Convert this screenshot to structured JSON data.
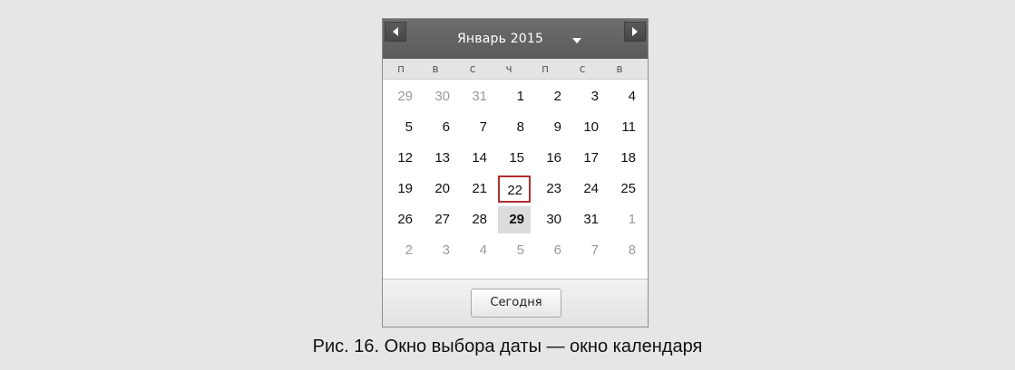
{
  "calendar": {
    "month_title": "Январь 2015",
    "prev_icon": "triangle-left-icon",
    "next_icon": "triangle-right-icon",
    "dropdown_icon": "triangle-down-icon",
    "weekdays": [
      "п",
      "в",
      "с",
      "ч",
      "п",
      "с",
      "в"
    ],
    "weeks": [
      [
        {
          "d": "29",
          "other": true
        },
        {
          "d": "30",
          "other": true
        },
        {
          "d": "31",
          "other": true
        },
        {
          "d": "1"
        },
        {
          "d": "2"
        },
        {
          "d": "3"
        },
        {
          "d": "4"
        }
      ],
      [
        {
          "d": "5"
        },
        {
          "d": "6"
        },
        {
          "d": "7"
        },
        {
          "d": "8"
        },
        {
          "d": "9"
        },
        {
          "d": "10"
        },
        {
          "d": "11"
        }
      ],
      [
        {
          "d": "12"
        },
        {
          "d": "13"
        },
        {
          "d": "14"
        },
        {
          "d": "15"
        },
        {
          "d": "16"
        },
        {
          "d": "17"
        },
        {
          "d": "18"
        }
      ],
      [
        {
          "d": "19"
        },
        {
          "d": "20"
        },
        {
          "d": "21"
        },
        {
          "d": "22",
          "selected": true
        },
        {
          "d": "23"
        },
        {
          "d": "24"
        },
        {
          "d": "25"
        }
      ],
      [
        {
          "d": "26"
        },
        {
          "d": "27"
        },
        {
          "d": "28"
        },
        {
          "d": "29",
          "today": true
        },
        {
          "d": "30"
        },
        {
          "d": "31"
        },
        {
          "d": "1",
          "other": true
        }
      ],
      [
        {
          "d": "2",
          "other": true
        },
        {
          "d": "3",
          "other": true
        },
        {
          "d": "4",
          "other": true
        },
        {
          "d": "5",
          "other": true
        },
        {
          "d": "6",
          "other": true
        },
        {
          "d": "7",
          "other": true
        },
        {
          "d": "8",
          "other": true
        }
      ]
    ],
    "today_button": "Сегодня",
    "colors": {
      "header": "#5f5f5f",
      "selected_border": "#b03030",
      "today_bg": "#dcdcdc",
      "other_month_text": "#9a9a9a"
    }
  },
  "caption": "Рис. 16. Окно выбора даты — окно календаря"
}
